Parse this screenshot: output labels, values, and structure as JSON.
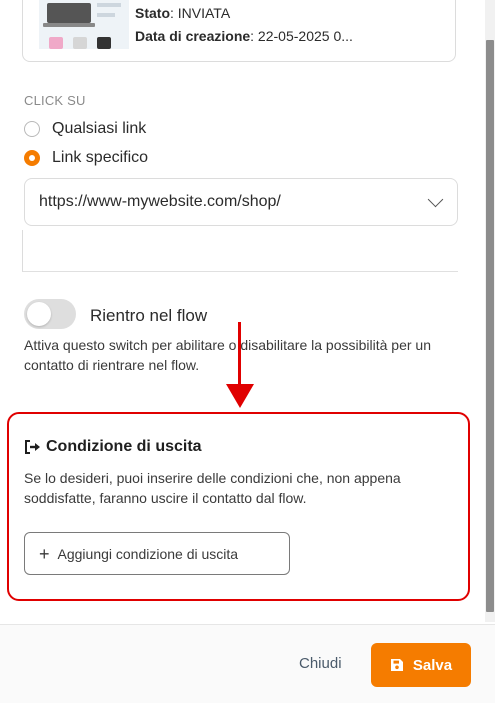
{
  "email_card": {
    "status_label": "Stato",
    "status_value": ": INVIATA",
    "created_label": "Data di creazione",
    "created_value": ": 22-05-2025 0..."
  },
  "click_section": {
    "label": "CLICK SU",
    "options": [
      {
        "label": "Qualsiasi link",
        "checked": false
      },
      {
        "label": "Link specifico",
        "checked": true
      }
    ],
    "selected_link": "https://www-mywebsite.com/shop/"
  },
  "reentry": {
    "toggle_label": "Rientro nel flow",
    "toggle_on": false,
    "helper": "Attiva questo switch per abilitare o disabilitare la possibilità per un contatto di rientrare nel flow."
  },
  "exit_condition": {
    "title": "Condizione di uscita",
    "description": "Se lo desideri, puoi inserire delle condizioni che, non appena soddisfatte, faranno uscire il contatto dal flow.",
    "add_button": "Aggiungi condizione di uscita"
  },
  "footer": {
    "close_label": "Chiudi",
    "save_label": "Salva"
  },
  "colors": {
    "accent": "#f57c00",
    "annotation": "#e00000"
  },
  "icons": [
    "sign-out-icon",
    "plus-icon",
    "save-icon",
    "chevron-down-icon"
  ]
}
